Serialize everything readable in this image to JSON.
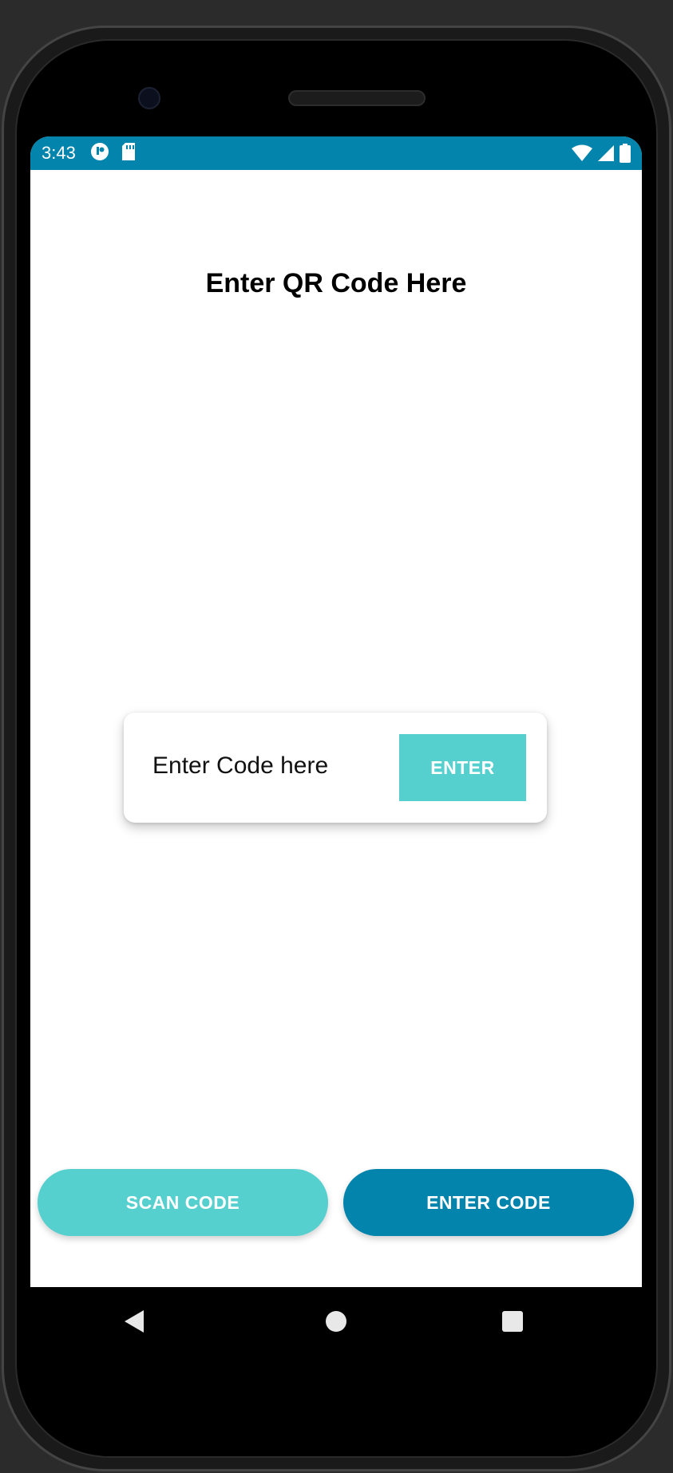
{
  "status_bar": {
    "time": "3:43",
    "left_icons": [
      "app-notification-icon",
      "sd-card-icon"
    ],
    "right_icons": [
      "wifi-icon",
      "signal-icon",
      "battery-icon"
    ],
    "color": "#0284ac"
  },
  "page": {
    "title": "Enter QR Code Here"
  },
  "code_card": {
    "input_placeholder": "Enter Code here",
    "input_value": "",
    "enter_label": "ENTER"
  },
  "bottom_buttons": {
    "scan_label": "SCAN CODE",
    "enter_code_label": "ENTER CODE"
  },
  "colors": {
    "accent_teal": "#56cfcf",
    "primary_blue": "#0284ac"
  },
  "nav_bar": {
    "icons": [
      "back-icon",
      "home-icon",
      "recents-icon"
    ]
  }
}
